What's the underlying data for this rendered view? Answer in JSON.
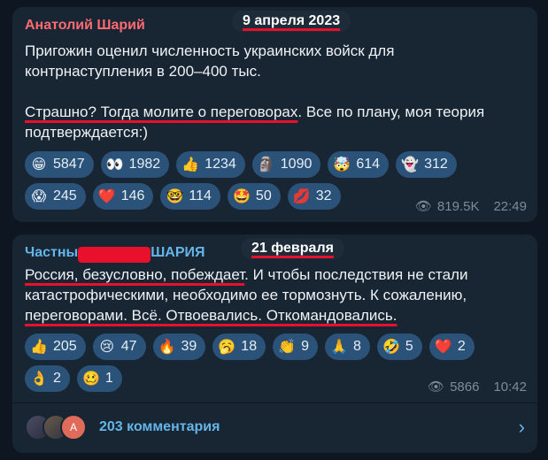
{
  "post1": {
    "author": "Анатолий Шарий",
    "date": "9 апреля 2023",
    "line1": "Пригожин оценил численность украинских войск для контрнаступления в 200–400 тыс.",
    "line2a": "Страшно? Тогда молите о переговорах",
    "line2b": ". Все по плану, моя теория подтверждается:)",
    "reactions": [
      {
        "emoji": "😁",
        "count": "5847"
      },
      {
        "emoji": "👀",
        "count": "1982"
      },
      {
        "emoji": "👍",
        "count": "1234"
      },
      {
        "emoji": "🗿",
        "count": "1090"
      },
      {
        "emoji": "🤯",
        "count": "614"
      },
      {
        "emoji": "👻",
        "count": "312"
      },
      {
        "emoji": "😱",
        "count": "245"
      },
      {
        "emoji": "❤️",
        "count": "146"
      },
      {
        "emoji": "🤓",
        "count": "114"
      },
      {
        "emoji": "🤩",
        "count": "50"
      },
      {
        "emoji": "💋",
        "count": "32"
      }
    ],
    "views": "819.5K",
    "time": "22:49"
  },
  "post2": {
    "author_a": "Частны",
    "author_b": "ШАРИЯ",
    "date": "21 февраля",
    "s1": "Россия, безусловно, побеждает",
    "s2": ". И чтобы последствия не стали катастрофическими, необходимо ее тормознуть. К сожалению, ",
    "s3": "переговорами. Всё. Отвоевались. Откомандовались.",
    "reactions": [
      {
        "emoji": "👍",
        "count": "205"
      },
      {
        "emoji": "😢",
        "count": "47"
      },
      {
        "emoji": "🔥",
        "count": "39"
      },
      {
        "emoji": "🥱",
        "count": "18"
      },
      {
        "emoji": "👏",
        "count": "9"
      },
      {
        "emoji": "🙏",
        "count": "8"
      },
      {
        "emoji": "🤣",
        "count": "5"
      },
      {
        "emoji": "❤️",
        "count": "2"
      },
      {
        "emoji": "👌",
        "count": "2"
      },
      {
        "emoji": "🥴",
        "count": "1"
      }
    ],
    "views": "5866",
    "time": "10:42",
    "comments_label": "203 комментария",
    "avatar_letter": "А"
  }
}
